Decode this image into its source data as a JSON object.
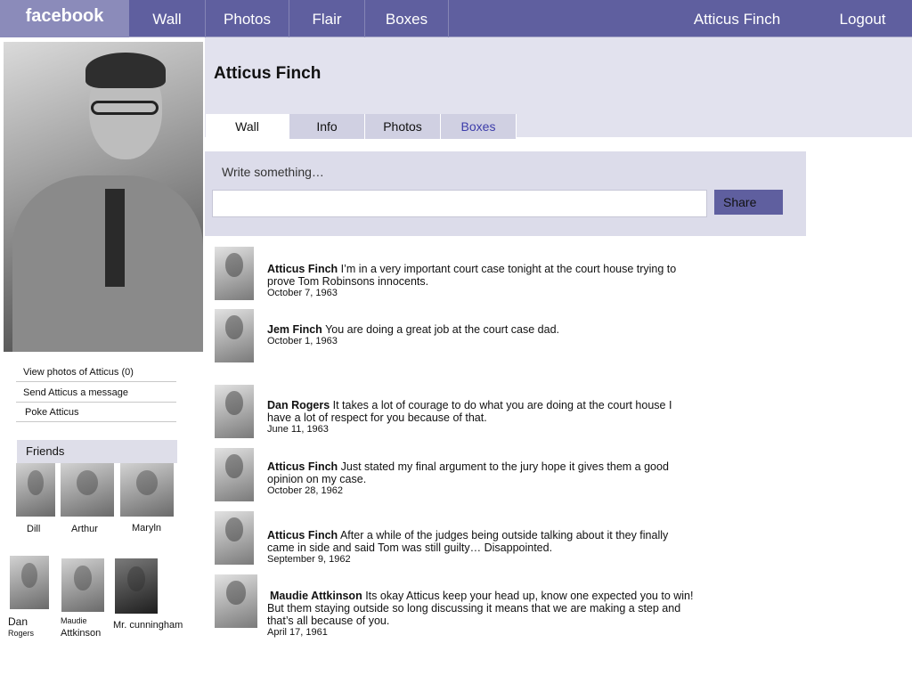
{
  "topnav": {
    "logo": "facebook",
    "items": [
      {
        "label": "Wall"
      },
      {
        "label": "Photos"
      },
      {
        "label": "Flair"
      },
      {
        "label": "Boxes"
      }
    ],
    "user_name": "Atticus Finch",
    "logout": "Logout"
  },
  "profile": {
    "name": "Atticus Finch",
    "tabs": [
      {
        "label": "Wall",
        "active": true
      },
      {
        "label": "Info"
      },
      {
        "label": "Photos"
      },
      {
        "label": "Boxes"
      }
    ],
    "photo_icon": "profile-photo"
  },
  "sidebar": {
    "links": [
      {
        "label": "View photos of Atticus (0)"
      },
      {
        "label": "Send Atticus a message"
      },
      {
        "label": "Poke Atticus"
      }
    ],
    "friends_heading": "Friends",
    "friends": [
      {
        "name": "Dill"
      },
      {
        "name": "Arthur"
      },
      {
        "name": "Maryln"
      },
      {
        "name_line1": "Dan",
        "name_line2": "Rogers"
      },
      {
        "name_line1": "Maudie",
        "name_line2": "Attkinson"
      },
      {
        "name": "Mr. cunningham"
      }
    ]
  },
  "composer": {
    "label": "Write something…",
    "value": "",
    "share": "Share"
  },
  "posts": [
    {
      "author": "Atticus Finch",
      "text": "I’m in a very important court case tonight at the court house trying to prove Tom Robinsons innocents.",
      "date": "October 7, 1963"
    },
    {
      "author": "Jem Finch",
      "text": "You are doing a great job  at the court case dad.",
      "date": "October 1, 1963"
    },
    {
      "author": "Dan Rogers",
      "text": "It takes a lot of courage to do what you are doing at the court house I have a lot of respect for you because of that.",
      "date": "June 11, 1963"
    },
    {
      "author": "Atticus Finch",
      "text": "Just stated my final argument to the jury hope it gives them a good opinion on my case.",
      "date": "October 28, 1962"
    },
    {
      "author": "Atticus Finch",
      "text": "After a while of the judges being outside talking about it they finally came in side and said Tom was still guilty… Disappointed.",
      "date": "September 9, 1962"
    },
    {
      "author": "Maudie Attkinson",
      "text": "Its okay Atticus keep your head up, know  one expected you to win! But them staying outside so long discussing it means that we are making a step and that’s all because of you.",
      "date": "April 17, 1961"
    }
  ],
  "colors": {
    "nav": "#5f5f9f",
    "logo_bg": "#8b8bba",
    "band": "#e2e2ee",
    "composer": "#dcdcea",
    "link_blue": "#3d3daa"
  }
}
